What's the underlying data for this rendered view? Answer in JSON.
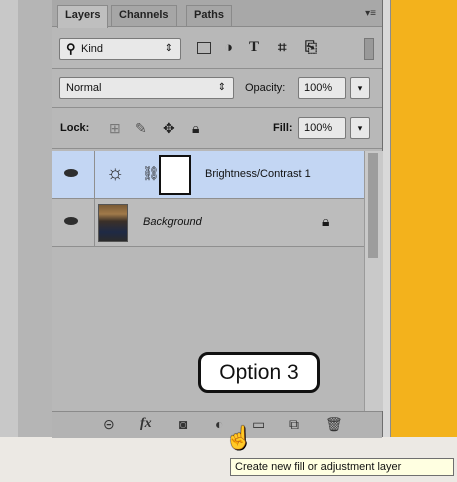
{
  "tabs": [
    "Layers",
    "Channels",
    "Paths"
  ],
  "panel_menu_icon": "panel-menu-icon",
  "filter": {
    "kind_label": "Kind",
    "icons": [
      "pixel-filter-icon",
      "adjustment-filter-icon",
      "type-filter-icon",
      "shape-filter-icon",
      "smart-object-filter-icon"
    ]
  },
  "blend": {
    "mode": "Normal",
    "opacity_label": "Opacity:",
    "opacity_value": "100%"
  },
  "lock": {
    "label": "Lock:",
    "fill_label": "Fill:",
    "fill_value": "100%"
  },
  "layers": [
    {
      "name": "Brightness/Contrast 1",
      "selected": true,
      "visible": true
    },
    {
      "name": "Background",
      "selected": false,
      "visible": true,
      "locked": true
    }
  ],
  "bottom_icons": [
    "link-layers-icon",
    "fx-icon",
    "add-mask-icon",
    "new-adjustment-layer-icon",
    "new-group-icon",
    "new-layer-icon",
    "delete-icon"
  ],
  "fx_label": "fx",
  "callout": "Option 3",
  "tooltip": "Create new fill or adjustment layer",
  "colors": {
    "canvas": "#f3b21c",
    "selection": "#c3d6f3",
    "panel": "#b8b8b8"
  }
}
